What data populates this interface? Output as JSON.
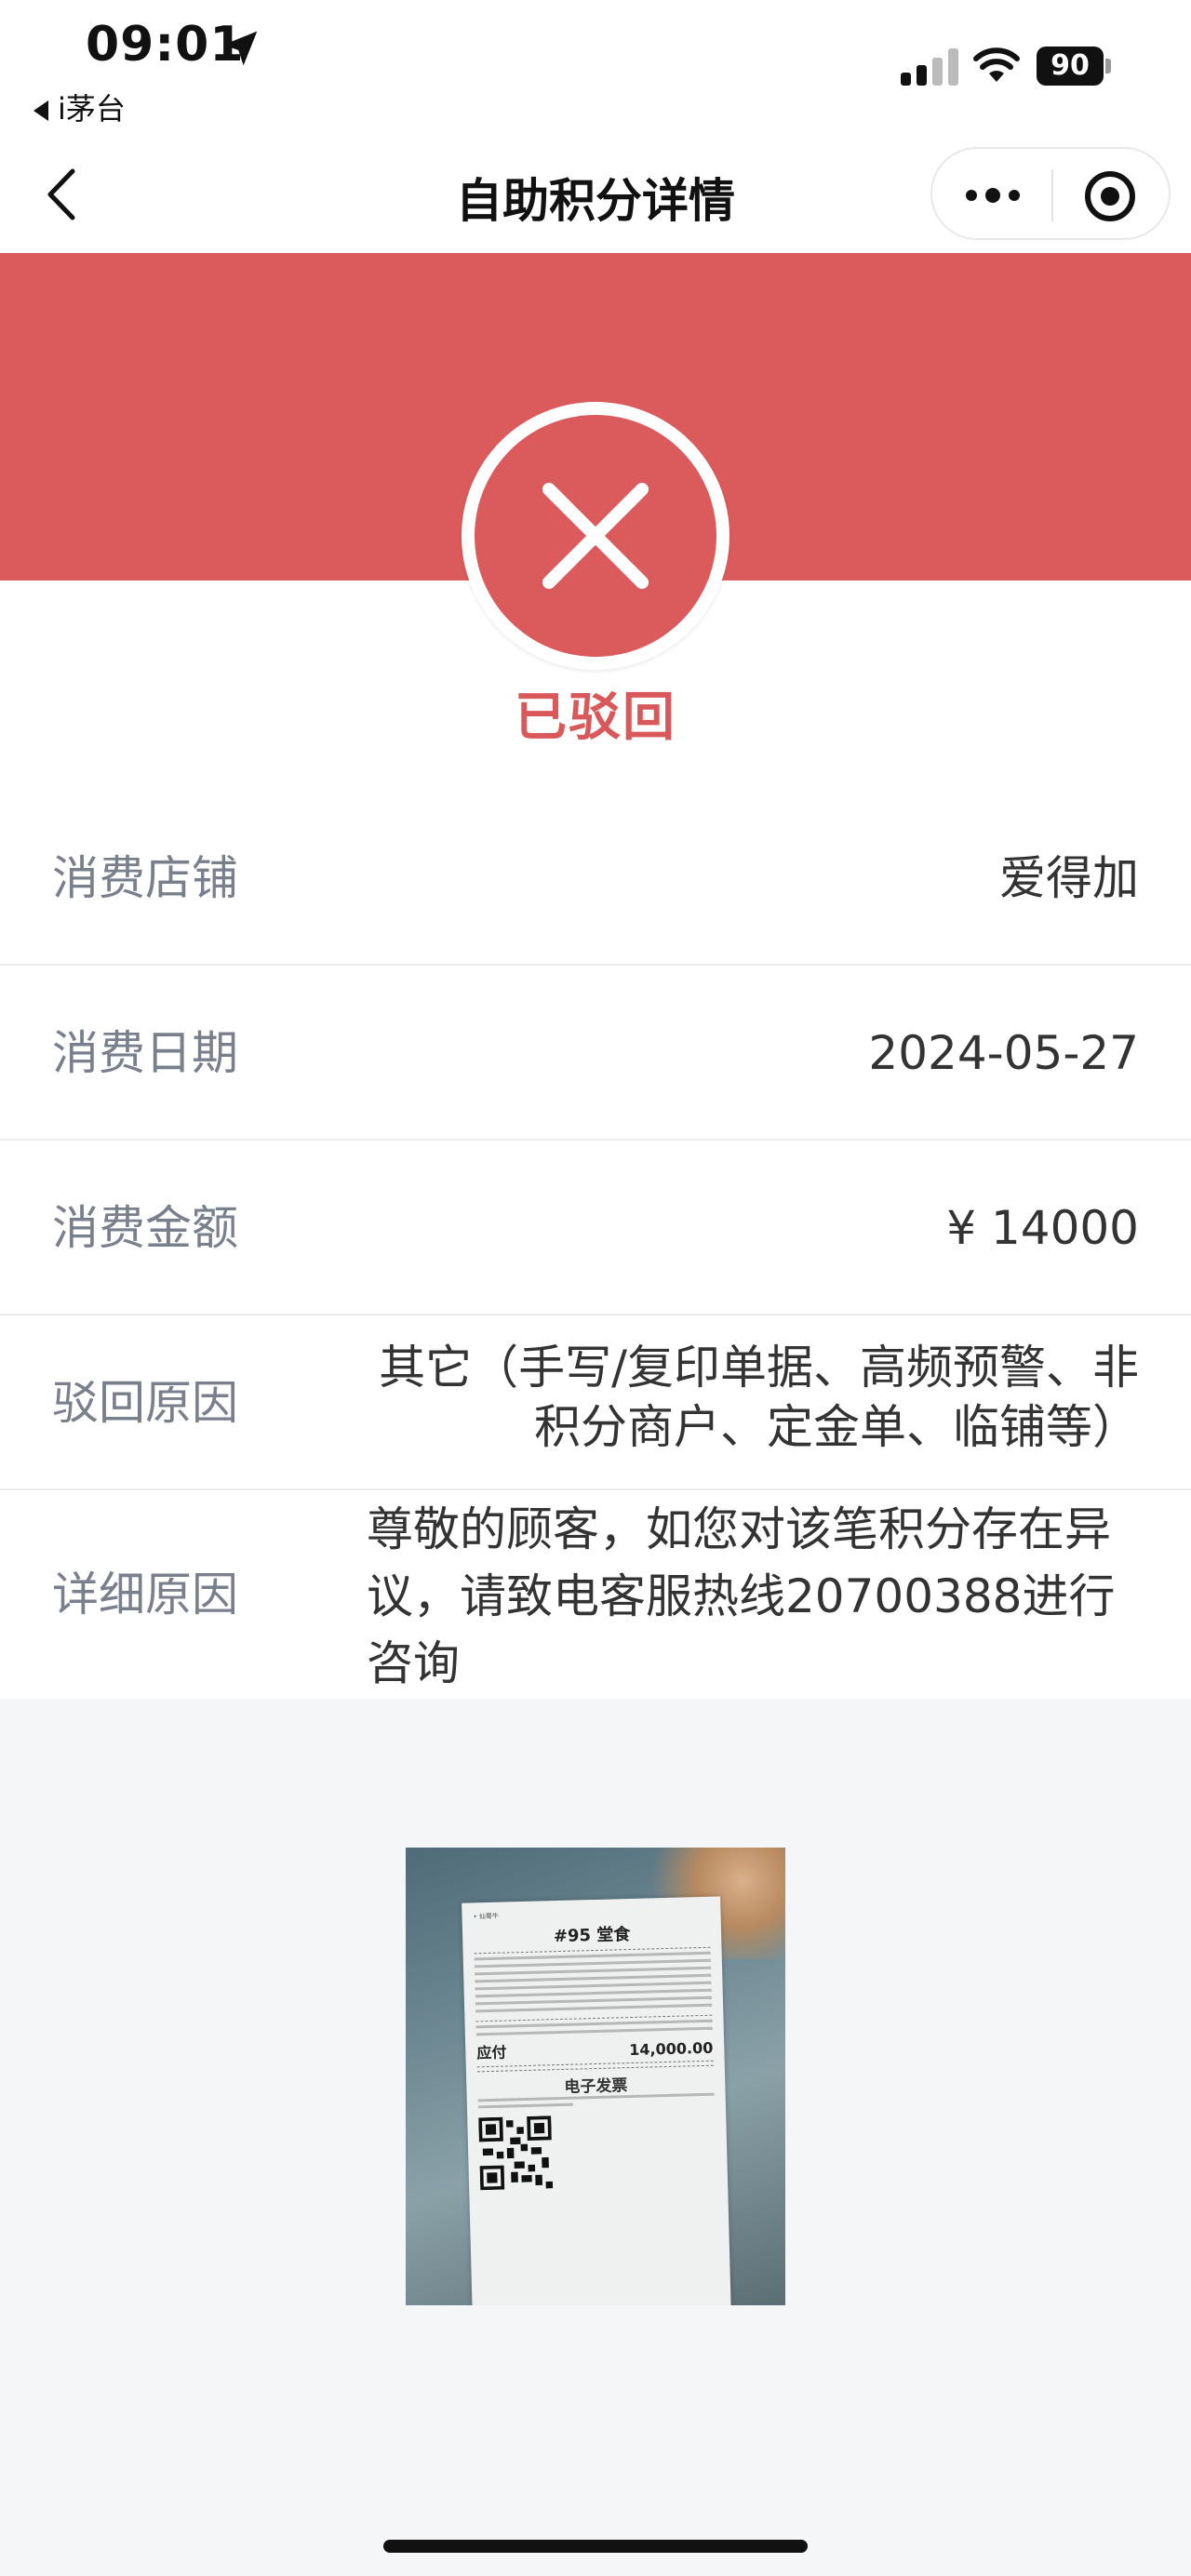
{
  "status_bar": {
    "time": "09:01",
    "back_app": "i茅台",
    "battery": "90"
  },
  "nav": {
    "title": "自助积分详情"
  },
  "status": {
    "text": "已驳回",
    "color": "#db5b5c"
  },
  "details": [
    {
      "label": "消费店铺",
      "value": "爱得加"
    },
    {
      "label": "消费日期",
      "value": "2024-05-27"
    },
    {
      "label": "消费金额",
      "value": "¥ 14000"
    },
    {
      "label": "驳回原因",
      "value": "其它（手写/复印单据、高频预警、非积分商户、定金单、临铺等）"
    },
    {
      "label": "详细原因",
      "value": "尊敬的顾客，如您对该笔积分存在异议，请致电客服热线20700388进行咨询"
    }
  ],
  "receipt": {
    "header": "• 仙蜀牛",
    "order_no": "#95 堂食",
    "total_label": "应付",
    "total_value": "14,000.00",
    "einvoice": "电子发票"
  }
}
